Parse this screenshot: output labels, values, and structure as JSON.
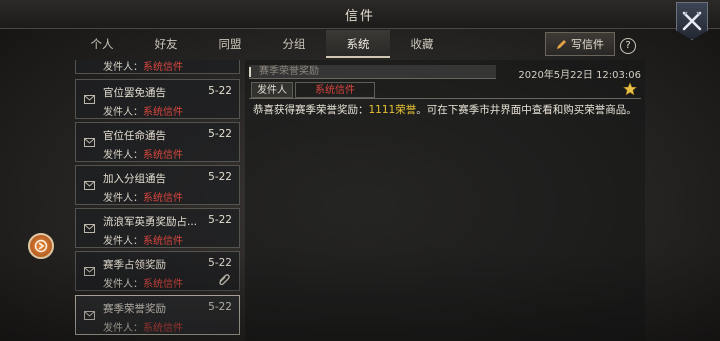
{
  "header": {
    "title": "信件"
  },
  "tabs": [
    {
      "label": "个人"
    },
    {
      "label": "好友"
    },
    {
      "label": "同盟"
    },
    {
      "label": "分组"
    },
    {
      "label": "系统",
      "active": true
    },
    {
      "label": "收藏"
    }
  ],
  "toolbar": {
    "write_label": "写信件",
    "help_label": "?"
  },
  "mail_list": {
    "items": [
      {
        "subject": "",
        "date": "",
        "from_prefix": "发件人：",
        "from": "系统信件"
      },
      {
        "subject": "官位罢免通告",
        "date": "5-22",
        "from_prefix": "发件人：",
        "from": "系统信件"
      },
      {
        "subject": "官位任命通告",
        "date": "5-22",
        "from_prefix": "发件人：",
        "from": "系统信件"
      },
      {
        "subject": "加入分组通告",
        "date": "5-22",
        "from_prefix": "发件人：",
        "from": "系统信件"
      },
      {
        "subject": "流浪军英勇奖励占...",
        "date": "5-22",
        "from_prefix": "发件人：",
        "from": "系统信件"
      },
      {
        "subject": "赛季占领奖励",
        "date": "5-22",
        "from_prefix": "发件人：",
        "from": "系统信件",
        "attachment": true
      },
      {
        "subject": "赛季荣誉奖励",
        "date": "5-22",
        "from_prefix": "发件人：",
        "from": "系统信件",
        "selected": true
      }
    ]
  },
  "detail": {
    "subject": "赛季荣誉奖励",
    "datetime": "2020年5月22日 12:03:06",
    "sender_label": "发件人",
    "sender_value": "系统信件",
    "body_prefix": "恭喜获得赛季荣誉奖励：",
    "body_highlight": "1111荣誉",
    "body_suffix": "。可在下赛季市井界面中查看和购买荣誉商品。"
  },
  "colors": {
    "system_sender": "#d8463e",
    "highlight": "#e6c233",
    "accent_button": "#e7893b"
  },
  "icons": [
    "close-swords-icon",
    "pencil-icon",
    "help-icon",
    "mail-icon",
    "paperclip-icon",
    "star-icon",
    "side-menu-icon"
  ]
}
